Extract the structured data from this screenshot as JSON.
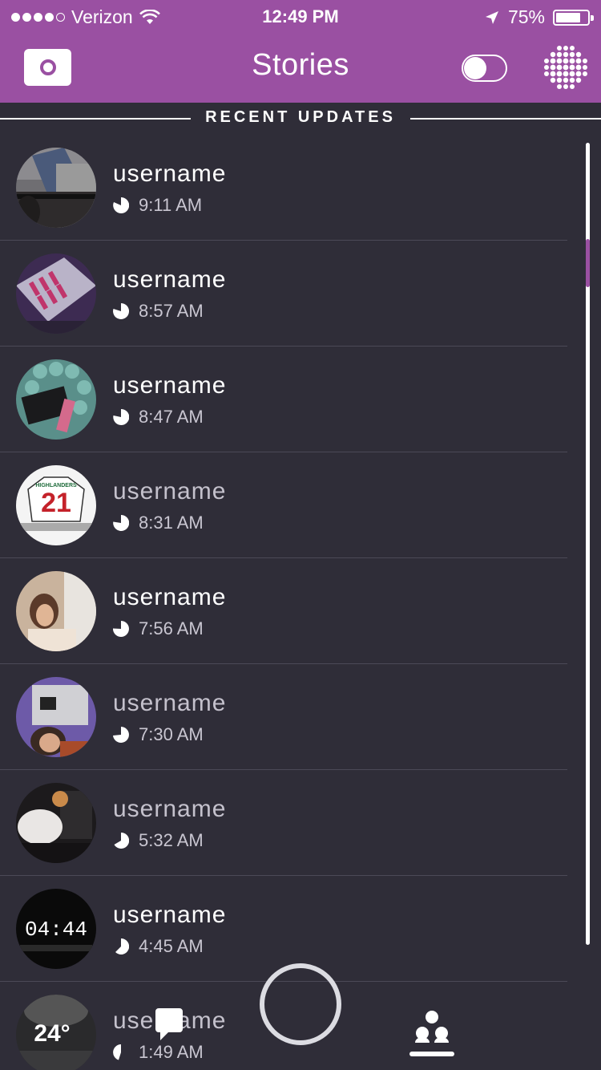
{
  "status": {
    "carrier": "Verizon",
    "time": "12:49 PM",
    "battery": "75%"
  },
  "header": {
    "title": "Stories",
    "left_icon": "camera-icon",
    "right_icon": "dot-grid-icon",
    "toggle_on": false
  },
  "section": {
    "label": "RECENT UPDATES"
  },
  "stories": [
    {
      "username": "username",
      "time": "9:11 AM",
      "seen": false
    },
    {
      "username": "username",
      "time": "8:57 AM",
      "seen": false
    },
    {
      "username": "username",
      "time": "8:47 AM",
      "seen": false
    },
    {
      "username": "username",
      "time": "8:31 AM",
      "seen": true
    },
    {
      "username": "username",
      "time": "7:56 AM",
      "seen": false
    },
    {
      "username": "username",
      "time": "7:30 AM",
      "seen": true
    },
    {
      "username": "username",
      "time": "5:32 AM",
      "seen": true
    },
    {
      "username": "username",
      "time": "4:45 AM",
      "seen": false
    },
    {
      "username": "username",
      "time": "1:49 AM",
      "seen": true
    }
  ],
  "thumbnails": {
    "jersey_text": "21",
    "jersey_team": "HIGHLANDERS",
    "clock_text": "04:44",
    "weather_temp": "24°"
  },
  "colors": {
    "accent": "#9a50a2",
    "background": "#2f2d38"
  }
}
